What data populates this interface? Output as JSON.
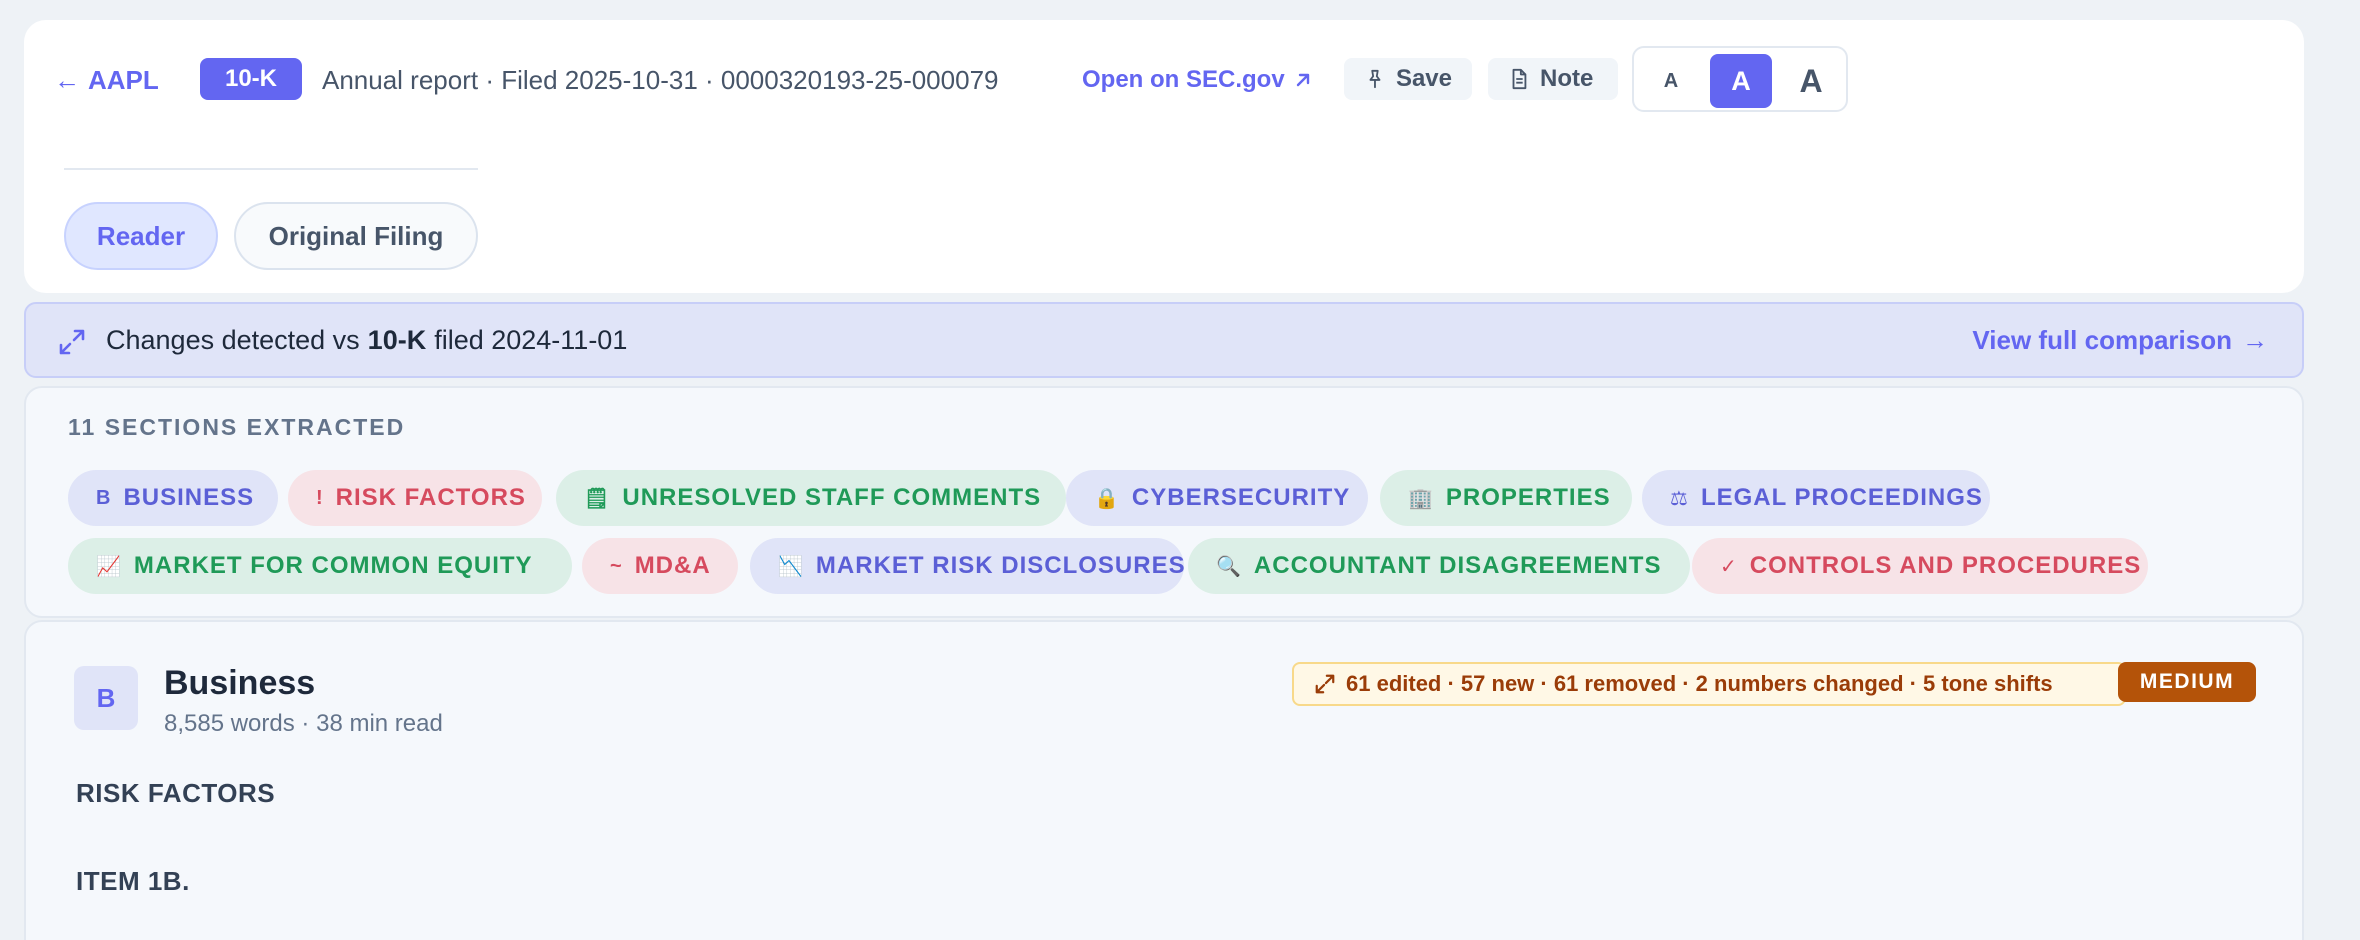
{
  "header": {
    "back_label": "AAPL",
    "form_type": "10-K",
    "filing_meta": "Annual report · Filed 2025-10-31 · 0000320193-25-000079",
    "sec_link": "Open on SEC.gov",
    "save_label": "Save",
    "note_label": "Note",
    "text_sizes": {
      "small": "A",
      "medium": "A",
      "large": "A",
      "selected": "medium"
    },
    "tabs": [
      {
        "label": "Reader",
        "active": true
      },
      {
        "label": "Original Filing",
        "active": false
      }
    ]
  },
  "changes_banner": {
    "prefix": "Changes detected vs",
    "form": "10-K",
    "suffix": "filed 2024-11-01",
    "link_label": "View full comparison"
  },
  "sections": {
    "title": "11 SECTIONS EXTRACTED",
    "items": [
      {
        "icon": "B",
        "label": "BUSINESS",
        "color": "indigo"
      },
      {
        "icon": "!",
        "label": "RISK FACTORS",
        "color": "red"
      },
      {
        "icon": "🗒",
        "label": "UNRESOLVED STAFF COMMENTS",
        "color": "green"
      },
      {
        "icon": "🔒",
        "label": "CYBERSECURITY",
        "color": "indigo"
      },
      {
        "icon": "🏢",
        "label": "PROPERTIES",
        "color": "green"
      },
      {
        "icon": "⚖",
        "label": "LEGAL PROCEEDINGS",
        "color": "indigo"
      },
      {
        "icon": "📈",
        "label": "MARKET FOR COMMON EQUITY",
        "color": "green"
      },
      {
        "icon": "~",
        "label": "MD&A",
        "color": "red"
      },
      {
        "icon": "📉",
        "label": "MARKET RISK DISCLOSURES",
        "color": "indigo"
      },
      {
        "icon": "🔍",
        "label": "ACCOUNTANT DISAGREEMENTS",
        "color": "green"
      },
      {
        "icon": "✓",
        "label": "CONTROLS AND PROCEDURES",
        "color": "red"
      }
    ]
  },
  "section_detail": {
    "letter": "B",
    "name": "Business",
    "words": "8,585 words",
    "read_time": "38 min read",
    "diff_summary": "61 edited · 57 new · 61 removed · 2 numbers changed · 5 tone shifts",
    "severity": "MEDIUM",
    "body_headings": [
      "RISK FACTORS",
      "ITEM 1B."
    ]
  },
  "colors": {
    "accent": "#6366f1",
    "severity_medium": "#b45309",
    "chip_indigo": "#5b5fd6",
    "chip_red": "#d64a5e",
    "chip_green": "#1f9a58"
  }
}
